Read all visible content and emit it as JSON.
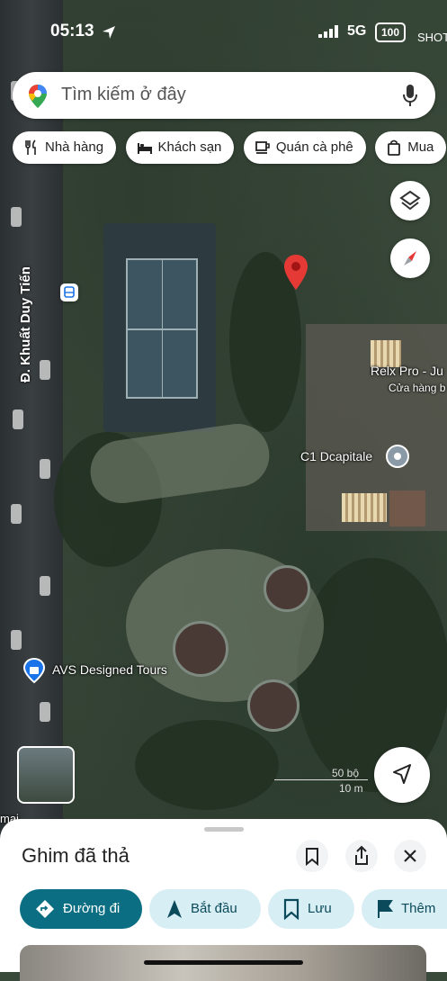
{
  "status_bar": {
    "time": "05:13",
    "network": "5G",
    "battery": "100",
    "shot_label": "SHOT"
  },
  "search": {
    "placeholder": "Tìm kiếm ở đây"
  },
  "chips": [
    {
      "label": "Nhà hàng",
      "icon": "fork-knife-icon"
    },
    {
      "label": "Khách sạn",
      "icon": "bed-icon"
    },
    {
      "label": "Quán cà phê",
      "icon": "coffee-icon"
    },
    {
      "label": "Mua",
      "icon": "shopping-bag-icon"
    }
  ],
  "map": {
    "street_label": "Đ. Khuất Duy Tiến",
    "places": [
      {
        "name": "Relx Pro - Ju",
        "subtitle": "Cửa hàng b"
      },
      {
        "name": "C1 Dcapitale"
      },
      {
        "name": "AVS Designed Tours"
      },
      {
        "name": "mai"
      }
    ],
    "scale": {
      "feet": "50 bộ",
      "meters": "10 m"
    }
  },
  "sheet": {
    "title": "Ghim đã thả",
    "actions": [
      {
        "label": "Đường đi"
      },
      {
        "label": "Bắt đầu"
      },
      {
        "label": "Lưu"
      },
      {
        "label": "Thêm"
      }
    ]
  },
  "colors": {
    "accent": "#0b6e83",
    "chip_bg": "#d7eef4",
    "pin": "#e53935"
  }
}
